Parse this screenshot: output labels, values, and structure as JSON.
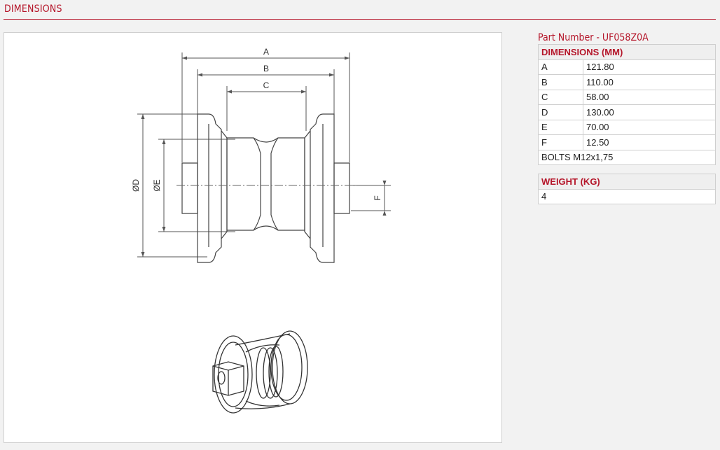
{
  "page": {
    "section_title": "DIMENSIONS"
  },
  "part": {
    "label": "Part Number - UF058Z0A"
  },
  "dimensions_table": {
    "header": "DIMENSIONS (MM)",
    "rows": [
      {
        "key": "A",
        "value": "121.80"
      },
      {
        "key": "B",
        "value": "110.00"
      },
      {
        "key": "C",
        "value": "58.00"
      },
      {
        "key": "D",
        "value": "130.00"
      },
      {
        "key": "E",
        "value": "70.00"
      },
      {
        "key": "F",
        "value": "12.50"
      }
    ],
    "bolts": "BOLTS M12x1,75"
  },
  "weight_table": {
    "header": "WEIGHT (KG)",
    "value": "4"
  },
  "drawing": {
    "labels": {
      "a": "A",
      "b": "B",
      "c": "C",
      "d": "ØD",
      "e": "ØE",
      "f": "F"
    }
  },
  "colors": {
    "accent": "#b5162a",
    "border": "#cfcfcf",
    "background": "#f2f2f2"
  }
}
